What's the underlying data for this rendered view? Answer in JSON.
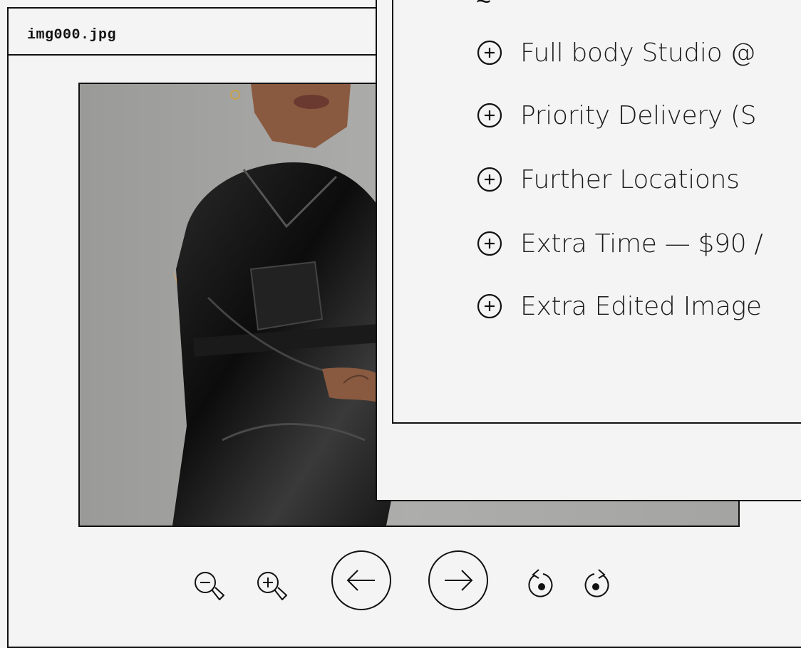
{
  "viewer": {
    "file_name": "img000.jpg",
    "photo_alt": "Person in black leather dress sitting on a wooden chair"
  },
  "controls": [
    {
      "name": "zoom-out-icon"
    },
    {
      "name": "zoom-in-icon"
    },
    {
      "name": "previous-arrow-icon"
    },
    {
      "name": "next-arrow-icon"
    },
    {
      "name": "rotate-left-icon"
    },
    {
      "name": "rotate-right-icon"
    }
  ],
  "package_panel": {
    "addons": [
      {
        "label": "Full body Studio @"
      },
      {
        "label": "Priority Delivery (S"
      },
      {
        "label": "Further Locations"
      },
      {
        "label": "Extra Time — $90 /"
      },
      {
        "label": "Extra Edited Image"
      }
    ]
  }
}
